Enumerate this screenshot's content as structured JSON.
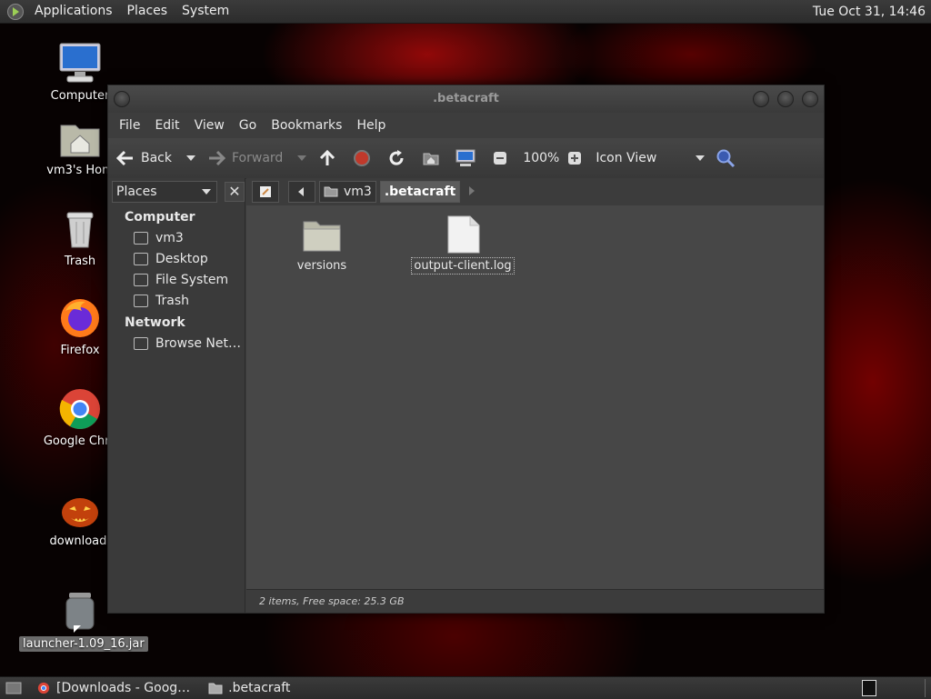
{
  "top_panel": {
    "menus": [
      "Applications",
      "Places",
      "System"
    ],
    "clock": "Tue Oct 31, 14:46"
  },
  "desktop": {
    "icons": [
      {
        "label": "Computer",
        "icon": "computer-icon"
      },
      {
        "label": "vm3's Hom",
        "icon": "home-folder-icon"
      },
      {
        "label": "Trash",
        "icon": "trash-icon"
      },
      {
        "label": "Firefox",
        "icon": "firefox-icon"
      },
      {
        "label": "Google Chro",
        "icon": "chrome-icon"
      },
      {
        "label": "download.",
        "icon": "pumpkin-image-icon"
      },
      {
        "label": "launcher-1.09_16.jar",
        "icon": "jar-icon"
      }
    ]
  },
  "window": {
    "title": ".betacraft",
    "menubar": [
      "File",
      "Edit",
      "View",
      "Go",
      "Bookmarks",
      "Help"
    ],
    "toolbar": {
      "back": "Back",
      "forward": "Forward",
      "zoom": "100%",
      "view_mode": "Icon View"
    },
    "sidebar": {
      "selector": "Places",
      "sections": [
        {
          "title": "Computer",
          "items": [
            "vm3",
            "Desktop",
            "File System",
            "Trash"
          ]
        },
        {
          "title": "Network",
          "items": [
            "Browse Net…"
          ]
        }
      ]
    },
    "pathbar": [
      "vm3",
      ".betacraft"
    ],
    "files": [
      {
        "name": "versions",
        "type": "folder"
      },
      {
        "name": "output-client.log",
        "type": "file"
      }
    ],
    "status": "2 items, Free space: 25.3 GB"
  },
  "taskbar": {
    "tasks": [
      {
        "label": "[Downloads - Goog…",
        "icon": "chrome-icon"
      },
      {
        "label": ".betacraft",
        "icon": "folder-icon"
      }
    ]
  },
  "colors": {
    "accent_green": "#9ccf56",
    "wallpaper_red": "#aa0a0a"
  }
}
